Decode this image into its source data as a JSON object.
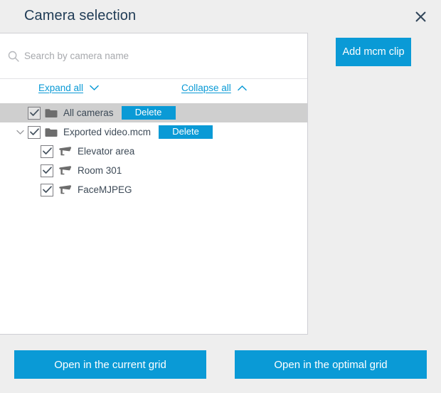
{
  "dialog": {
    "title": "Camera selection",
    "close_icon": "close-icon"
  },
  "search": {
    "placeholder": "Search by camera name",
    "value": "",
    "icon": "search-icon"
  },
  "tree_actions": {
    "expand": {
      "label": "Expand all",
      "icon": "chevron-down-icon"
    },
    "collapse": {
      "label": "Collapse all",
      "icon": "chevron-up-icon"
    }
  },
  "tree": {
    "nodes": [
      {
        "label": "All cameras",
        "icon": "folder-icon",
        "checked": true,
        "selected": true,
        "depth": 0,
        "has_chevron": false,
        "delete_label": "Delete"
      },
      {
        "label": "Exported video.mcm",
        "icon": "folder-icon",
        "checked": true,
        "selected": false,
        "depth": 1,
        "has_chevron": true,
        "expanded": true,
        "delete_label": "Delete"
      },
      {
        "label": "Elevator area",
        "icon": "camera-icon",
        "checked": true,
        "selected": false,
        "depth": 2,
        "has_chevron": false,
        "delete_label": null
      },
      {
        "label": "Room 301",
        "icon": "camera-icon",
        "checked": true,
        "selected": false,
        "depth": 2,
        "has_chevron": false,
        "delete_label": null
      },
      {
        "label": "FaceMJPEG",
        "icon": "camera-icon",
        "checked": true,
        "selected": false,
        "depth": 2,
        "has_chevron": false,
        "delete_label": null
      }
    ]
  },
  "side": {
    "add_clip_label": "Add mcm clip"
  },
  "footer": {
    "open_current_label": "Open in the current grid",
    "open_optimal_label": "Open in the optimal grid"
  },
  "colors": {
    "accent": "#0a9ad6",
    "background": "#eeeeee",
    "panel": "#ffffff",
    "selected_row": "#cfcfcf",
    "title": "#1f3b55",
    "text": "#3d4a57",
    "icon_gray": "#6d6d6d"
  }
}
